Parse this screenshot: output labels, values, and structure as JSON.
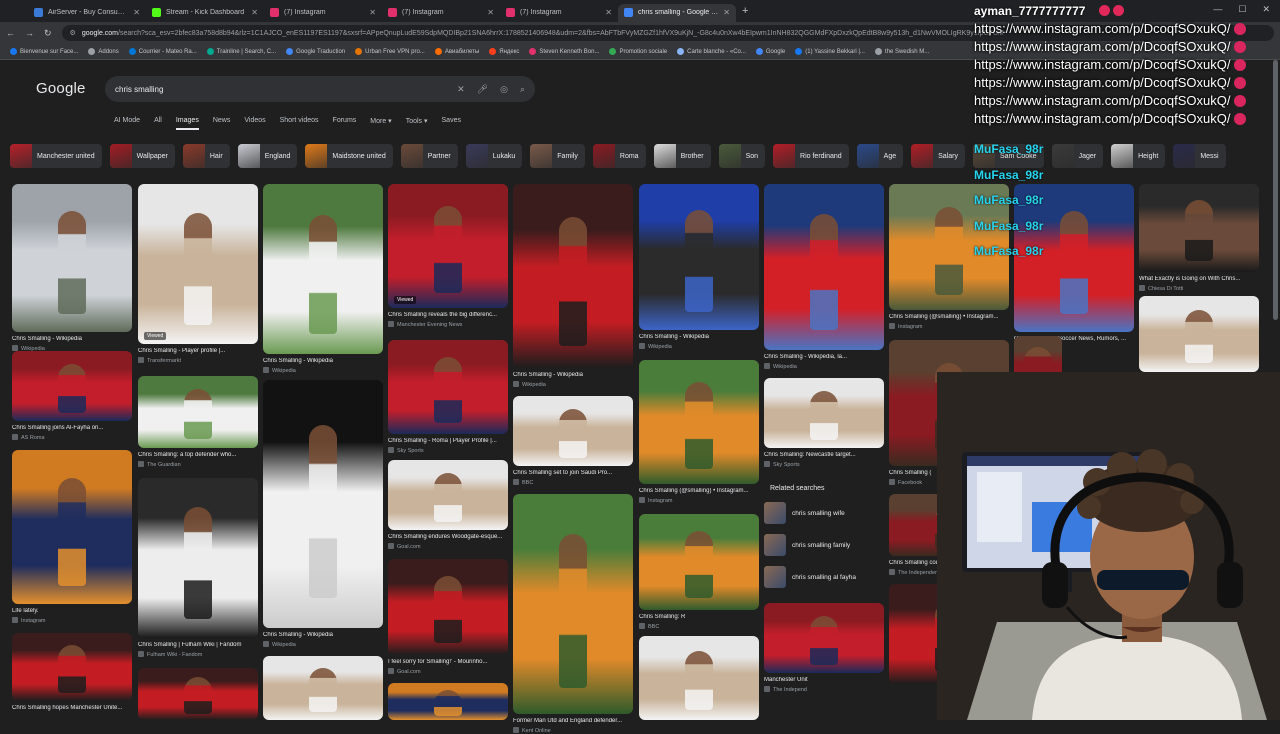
{
  "browser": {
    "tabs": [
      {
        "title": "AirServer - Buy Consumer Licen",
        "favicon_color": "#3c7ad8",
        "active": false
      },
      {
        "title": "Stream - Kick Dashboard",
        "favicon_color": "#53fc18",
        "active": false
      },
      {
        "title": "(7) Instagram",
        "favicon_color": "#e1306c",
        "active": false
      },
      {
        "title": "(7) Instagram",
        "favicon_color": "#e1306c",
        "active": false
      },
      {
        "title": "(7) Instagram",
        "favicon_color": "#e1306c",
        "active": false
      },
      {
        "title": "chris smalling - Google Search",
        "favicon_color": "#4285f4",
        "active": true
      }
    ],
    "newtab": "+",
    "address": {
      "host": "google.com",
      "path": "/search?sca_esv=2bfec83a758d8b94&rlz=1C1AJCO_enES1197ES1197&sxsrf=APpeQnupLudE59SdpMQDIBp21SNA6hrrX:1788521406948&udm=2&fbs=AbFTbFVyMZGZf1hfVX9uKjN_-G8c4u0nXw4bEIpwm1InNH832QGGMdFXpDxzkQpEdtB8w9y513h_d1NwVMOLIgRK9y1IpG7UM"
    },
    "bookmarks": [
      {
        "label": "Bienvenue sur Face...",
        "color": "#1877f2"
      },
      {
        "label": "Addons",
        "color": "#9aa0a6"
      },
      {
        "label": "Courrier - Mateo Ra...",
        "color": "#0078d4"
      },
      {
        "label": "Trainline | Search, C...",
        "color": "#00a88f"
      },
      {
        "label": "Google Traduction",
        "color": "#4285f4"
      },
      {
        "label": "Urban Free VPN pro...",
        "color": "#e37400"
      },
      {
        "label": "Авиабилеты",
        "color": "#ff6d00"
      },
      {
        "label": "Яндекс",
        "color": "#fc3f1d"
      },
      {
        "label": "Steven Kenneth Bon...",
        "color": "#e1306c"
      },
      {
        "label": "Promotion sociale",
        "color": "#34a853"
      },
      {
        "label": "Carte blanche - «Co...",
        "color": "#8ab4f8"
      },
      {
        "label": "Google",
        "color": "#4285f4"
      },
      {
        "label": "(1) Yassine Bekkari |...",
        "color": "#1877f2"
      },
      {
        "label": "the Swedish M...",
        "color": "#9aa0a6"
      }
    ]
  },
  "google": {
    "logo": "Google",
    "query": "chris smalling",
    "tabs": [
      "AI Mode",
      "All",
      "Images",
      "News",
      "Videos",
      "Short videos",
      "Forums",
      "More ▾",
      "Tools ▾",
      "Saves"
    ],
    "chips": [
      {
        "label": "Manchester united",
        "color": "#b8202a"
      },
      {
        "label": "Wallpaper",
        "color": "#a31c24"
      },
      {
        "label": "Hair",
        "color": "#8a3a2a"
      },
      {
        "label": "England",
        "color": "#c9ccd3"
      },
      {
        "label": "Maidstone united",
        "color": "#e07a1a"
      },
      {
        "label": "Partner",
        "color": "#6a4a3a"
      },
      {
        "label": "Lukaku",
        "color": "#3a3a5a"
      },
      {
        "label": "Family",
        "color": "#7a5a4a"
      },
      {
        "label": "Roma",
        "color": "#8b1a22"
      },
      {
        "label": "Brother",
        "color": "#dcdcdc"
      },
      {
        "label": "Son",
        "color": "#4a5a3a"
      },
      {
        "label": "Rio ferdinand",
        "color": "#b31d27"
      },
      {
        "label": "Age",
        "color": "#2a4a8a"
      },
      {
        "label": "Salary",
        "color": "#b01e26"
      },
      {
        "label": "Sam Cooke",
        "color": "#5a4a3a"
      },
      {
        "label": "Jager",
        "color": "#3a3a3a"
      },
      {
        "label": "Height",
        "color": "#d0d0d0"
      },
      {
        "label": "Messi",
        "color": "#2a2a4a"
      }
    ],
    "results": [
      {
        "caption": "Chris Smalling - Wikipedia",
        "source": "Wikipedia",
        "viewed": ""
      },
      {
        "caption": "Chris Smalling - Player profile |...",
        "source": "Transfermarkt",
        "viewed": "Viewed"
      },
      {
        "caption": "Chris Smalling - Wikipedia",
        "source": "Wikipedia",
        "viewed": ""
      },
      {
        "caption": "Chris Smalling reveals the big differenc...",
        "source": "Manchester Evening News",
        "viewed": "Viewed"
      },
      {
        "caption": "Chris Smalling - Wikipedia",
        "source": "Wikipedia",
        "viewed": ""
      },
      {
        "caption": "Chris Smalling - Wikipedia",
        "source": "Wikipedia",
        "viewed": ""
      },
      {
        "caption": "Chris Smalling - Wikipedia, la...",
        "source": "Wikipedia",
        "viewed": ""
      },
      {
        "caption": "Chris Smalling (@smalling) • Instagram...",
        "source": "Instagram",
        "viewed": ""
      },
      {
        "caption": "Chris Smalling - Soccer News, Rumors, ...",
        "source": "FOX Sports",
        "viewed": ""
      },
      {
        "caption": "What Exactly is Going on With Chris...",
        "source": "Chiesa Di Totti",
        "viewed": ""
      },
      {
        "caption": "Chris Smalling joins Al-Fayha on...",
        "source": "AS Roma",
        "viewed": ""
      },
      {
        "caption": "Chris Smalling: a top defender who...",
        "source": "The Guardian",
        "viewed": ""
      },
      {
        "caption": "Chris Smalling - Roma | Player Profile |...",
        "source": "Sky Sports",
        "viewed": ""
      },
      {
        "caption": "Chris Smalling set to join Saudi Pro...",
        "source": "BBC",
        "viewed": ""
      },
      {
        "caption": "Chris Smalling (@smalling) • Instagram...",
        "source": "Instagram",
        "viewed": ""
      },
      {
        "caption": "Chris Smalling: Newcastle target...",
        "source": "Sky Sports",
        "viewed": ""
      },
      {
        "caption": "Chris Smalling (",
        "source": "Facebook",
        "viewed": ""
      },
      {
        "caption": "Life lately.",
        "source": "Instagram",
        "viewed": ""
      },
      {
        "caption": "Chris Smalling | Fulham Wiki | Fandom",
        "source": "Fulham Wiki - Fandom",
        "viewed": ""
      },
      {
        "caption": "Chris Smalling - Wikipedia",
        "source": "Wikipedia",
        "viewed": ""
      },
      {
        "caption": "Chris Smalling endures Woodgate-esque...",
        "source": "Goal.com",
        "viewed": ""
      },
      {
        "caption": "Former Man Utd and England defender...",
        "source": "Kent Online",
        "viewed": ""
      },
      {
        "caption": "Chris Smalling: R",
        "source": "BBC",
        "viewed": ""
      },
      {
        "caption": "Chris Smalling could make Roma debut ...",
        "source": "The Independent",
        "viewed": ""
      },
      {
        "caption": "I feel sorry for Smalling!' - Mourinho...",
        "source": "Goal.com",
        "viewed": ""
      },
      {
        "caption": "Manchester Unit",
        "source": "The Independ",
        "viewed": ""
      },
      {
        "caption": "Chris Smalling hopes Manchester Unite...",
        "source": "",
        "viewed": ""
      }
    ],
    "related": {
      "heading": "Related searches",
      "items": [
        "chris smalling wife",
        "chris smalling family",
        "chris smalling al fayha"
      ]
    }
  },
  "overlay": {
    "handle": "ayman_7777777777",
    "urls": [
      "https://www.instagram.com/p/DcoqfSOxukQ/",
      "https://www.instagram.com/p/DcoqfSOxukQ/",
      "https://www.instagram.com/p/DcoqfSOxukQ/",
      "https://www.instagram.com/p/DcoqfSOxukQ/",
      "https://www.instagram.com/p/DcoqfSOxukQ/",
      "https://www.instagram.com/p/DcoqfSOxukQ/"
    ],
    "chat": [
      "MuFasa_98r",
      "MuFasa_98r",
      "MuFasa_98r",
      "MuFasa_98r",
      "MuFasa_98r"
    ],
    "accent": "#27d4ee"
  }
}
